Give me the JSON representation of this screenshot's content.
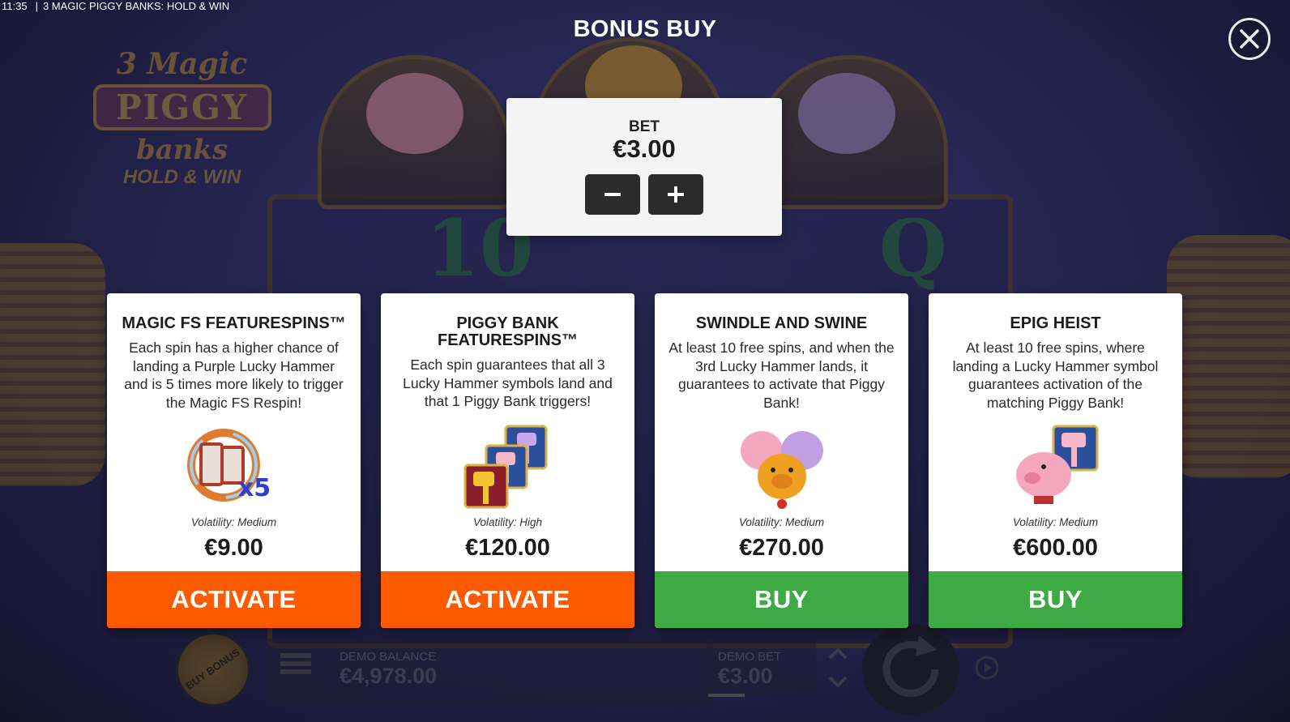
{
  "status_bar": {
    "time": "11:35",
    "separator": "|",
    "title": "3 MAGIC PIGGY BANKS: HOLD & WIN"
  },
  "background": {
    "logo": {
      "line1": "3 Magic",
      "line2": "PIGGY",
      "line3": "banks",
      "line4": "HOLD & WIN"
    },
    "reel_symbols": [
      "10",
      "Q"
    ]
  },
  "modal": {
    "title": "BONUS BUY",
    "close_icon": "close-icon"
  },
  "bet_panel": {
    "label": "BET",
    "value": "€3.00",
    "minus_icon": "minus-icon",
    "plus_icon": "plus-icon"
  },
  "colors": {
    "activate": "#ff5a00",
    "buy": "#3eaa44",
    "card_bg": "#ffffff",
    "bet_button": "#2b2b2b"
  },
  "cards": [
    {
      "title": "MAGIC FS FEATURESPINS™",
      "description": "Each spin has a higher chance of landing a Purple Lucky Hammer and is 5 times more likely to trigger the Magic FS Respin!",
      "icon": "fs-x5-icon",
      "icon_text": "x5",
      "volatility": "Volatility: Medium",
      "price": "€9.00",
      "button": "ACTIVATE",
      "button_color": "#ff5a00"
    },
    {
      "title": "PIGGY BANK FEATURESPINS™",
      "description": "Each spin guarantees that all 3 Lucky Hammer symbols land and that 1 Piggy Bank triggers!",
      "icon": "lucky-hammers-icon",
      "volatility": "Volatility: High",
      "price": "€120.00",
      "button": "ACTIVATE",
      "button_color": "#ff5a00"
    },
    {
      "title": "SWINDLE AND SWINE",
      "description": "At least 10 free spins, and when the 3rd Lucky Hammer lands, it guarantees to activate that Piggy Bank!",
      "icon": "three-piggies-icon",
      "volatility": "Volatility: Medium",
      "price": "€270.00",
      "button": "BUY",
      "button_color": "#3eaa44"
    },
    {
      "title": "EPIG HEIST",
      "description": "At least 10 free spins, where landing a Lucky Hammer symbol guarantees activation of the matching Piggy Bank!",
      "icon": "piggy-hammer-icon",
      "volatility": "Volatility: Medium",
      "price": "€600.00",
      "button": "BUY",
      "button_color": "#3eaa44"
    }
  ],
  "hud": {
    "buy_bonus": "BUY BONUS",
    "balance_label": "DEMO BALANCE",
    "balance_value": "€4,978.00",
    "bet_label": "DEMO BET",
    "bet_value": "€3.00"
  }
}
